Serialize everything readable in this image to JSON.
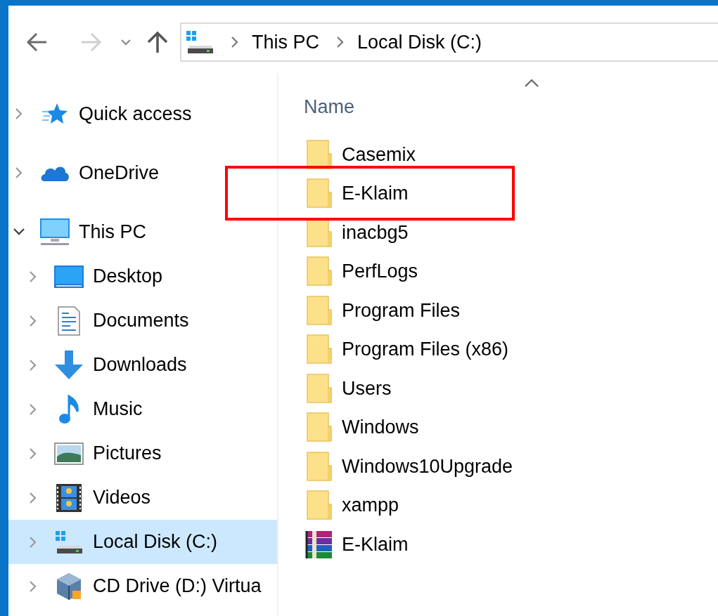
{
  "toolbar": {
    "back": {
      "disabled": false
    },
    "forward": {
      "disabled": true
    }
  },
  "address": {
    "segments": [
      "This PC",
      "Local Disk (C:)"
    ]
  },
  "navigation": [
    {
      "label": "Quick access",
      "kind": "quick-access",
      "expanded": false,
      "selected": false
    },
    {
      "label": "OneDrive",
      "kind": "cloud",
      "expanded": false,
      "selected": false
    },
    {
      "label": "This PC",
      "kind": "computer",
      "expanded": true,
      "selected": false,
      "children": [
        {
          "label": "Desktop",
          "kind": "desktop",
          "expanded": false,
          "selected": false
        },
        {
          "label": "Documents",
          "kind": "documents",
          "expanded": false,
          "selected": false
        },
        {
          "label": "Downloads",
          "kind": "downloads",
          "expanded": false,
          "selected": false
        },
        {
          "label": "Music",
          "kind": "music",
          "expanded": false,
          "selected": false
        },
        {
          "label": "Pictures",
          "kind": "pictures",
          "expanded": false,
          "selected": false
        },
        {
          "label": "Videos",
          "kind": "videos",
          "expanded": false,
          "selected": false
        },
        {
          "label": "Local Disk (C:)",
          "kind": "drive",
          "expanded": false,
          "selected": true
        },
        {
          "label": "CD Drive (D:) Virtua",
          "kind": "cd-drive",
          "expanded": false,
          "selected": false
        }
      ]
    }
  ],
  "file_list": {
    "column": "Name",
    "items": [
      {
        "name": "Casemix",
        "kind": "folder"
      },
      {
        "name": "E-Klaim",
        "kind": "folder"
      },
      {
        "name": "inacbg5",
        "kind": "folder"
      },
      {
        "name": "PerfLogs",
        "kind": "folder"
      },
      {
        "name": "Program Files",
        "kind": "folder"
      },
      {
        "name": "Program Files (x86)",
        "kind": "folder"
      },
      {
        "name": "Users",
        "kind": "folder"
      },
      {
        "name": "Windows",
        "kind": "folder"
      },
      {
        "name": "Windows10Upgrade",
        "kind": "folder"
      },
      {
        "name": "xampp",
        "kind": "folder"
      },
      {
        "name": "E-Klaim",
        "kind": "archive"
      }
    ]
  }
}
